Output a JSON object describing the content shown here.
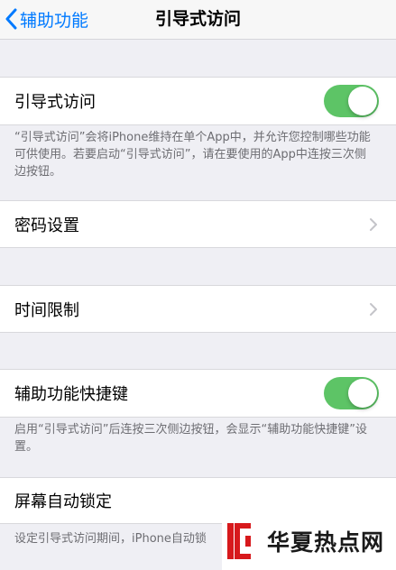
{
  "nav": {
    "back_label": "辅助功能",
    "title": "引导式访问"
  },
  "guided_access": {
    "label": "引导式访问",
    "toggle_on": true,
    "note": "“引导式访问”会将iPhone维持在单个App中，并允许您控制哪些功能可供使用。若要启动“引导式访问”，请在要使用的App中连按三次侧边按钮。"
  },
  "passcode": {
    "label": "密码设置"
  },
  "time_limits": {
    "label": "时间限制"
  },
  "shortcut": {
    "label": "辅助功能快捷键",
    "toggle_on": true,
    "note": "启用“引导式访问”后连按三次侧边按钮，会显示“辅助功能快捷键”设置。"
  },
  "auto_lock": {
    "label": "屏幕自动锁定",
    "note": "设定引导式访问期间，iPhone自动锁"
  },
  "watermark": {
    "text": "华夏热点网"
  },
  "colors": {
    "accent": "#007aff",
    "toggle_on": "#5dc466",
    "background": "#efeff4"
  }
}
